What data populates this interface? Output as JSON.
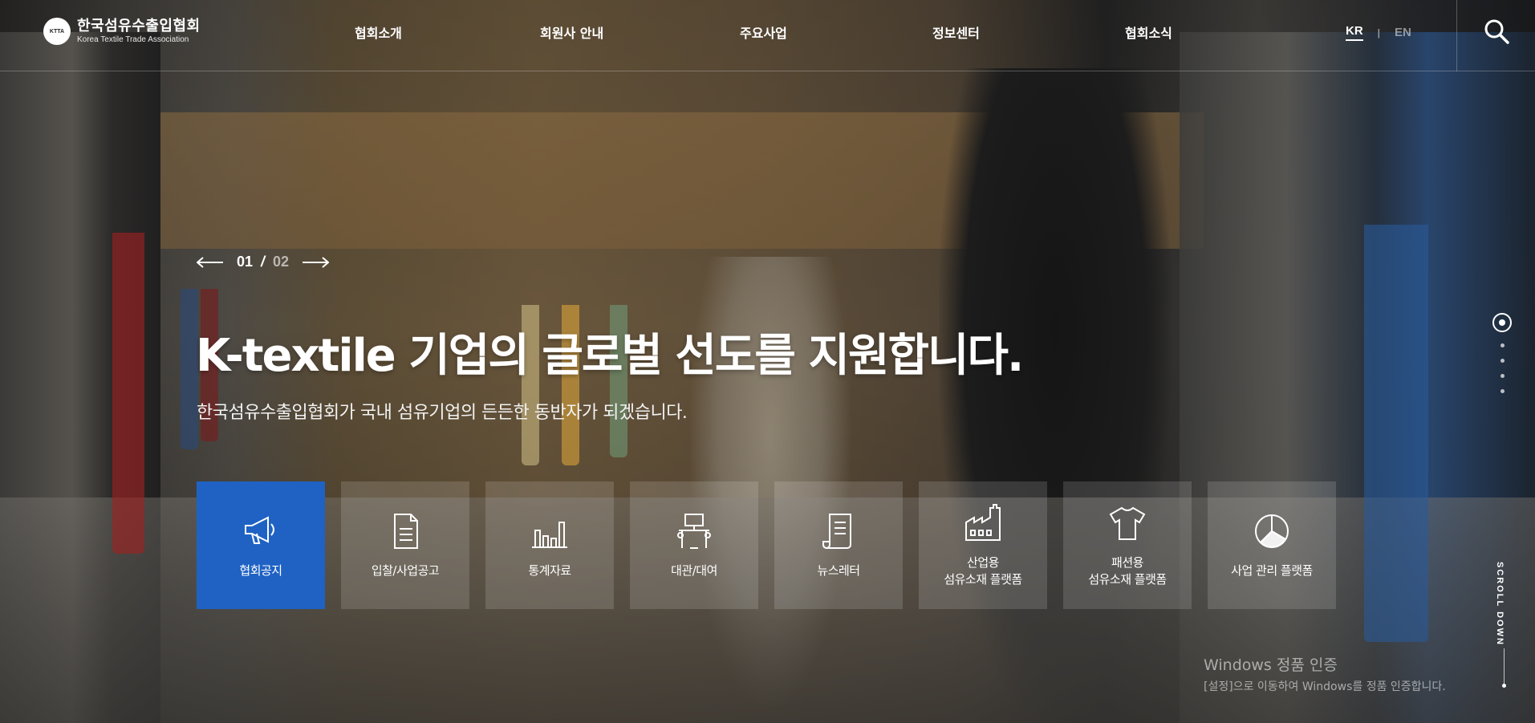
{
  "logo": {
    "badge": "KTTA",
    "name_kr": "한국섬유수출입협회",
    "name_en": "Korea Textile Trade Association"
  },
  "nav": {
    "items": [
      {
        "label": "협회소개"
      },
      {
        "label": "회원사 안내"
      },
      {
        "label": "주요사업"
      },
      {
        "label": "정보센터"
      },
      {
        "label": "협회소식"
      }
    ]
  },
  "lang": {
    "kr": "KR",
    "sep": "|",
    "en": "EN",
    "active": "KR"
  },
  "slider": {
    "current": "01",
    "separator": "/",
    "total": "02"
  },
  "hero": {
    "title": "K-textile 기업의 글로벌 선도를 지원합니다.",
    "subtitle": "한국섬유수출입협회가 국내 섬유기업의 든든한 동반자가 되겠습니다."
  },
  "quick_menu": [
    {
      "label": "협회공지",
      "icon": "megaphone-icon",
      "active": true
    },
    {
      "label": "입찰/사업공고",
      "icon": "document-icon"
    },
    {
      "label": "통계자료",
      "icon": "bar-chart-icon"
    },
    {
      "label": "대관/대여",
      "icon": "podium-icon"
    },
    {
      "label": "뉴스레터",
      "icon": "newsletter-icon"
    },
    {
      "label": "산업용\n섬유소재 플랫폼",
      "icon": "factory-icon"
    },
    {
      "label": "패션용\n섬유소재 플랫폼",
      "icon": "tshirt-icon"
    },
    {
      "label": "사업 관리 플랫폼",
      "icon": "pie-chart-icon"
    }
  ],
  "pager": {
    "count": 5,
    "active_index": 0
  },
  "scroll": {
    "label": "SCROLL DOWN"
  },
  "watermark": {
    "title": "Windows 정품 인증",
    "subtitle": "[설정]으로 이동하여 Windows를 정품 인증합니다."
  },
  "colors": {
    "accent": "#1f62c4"
  }
}
